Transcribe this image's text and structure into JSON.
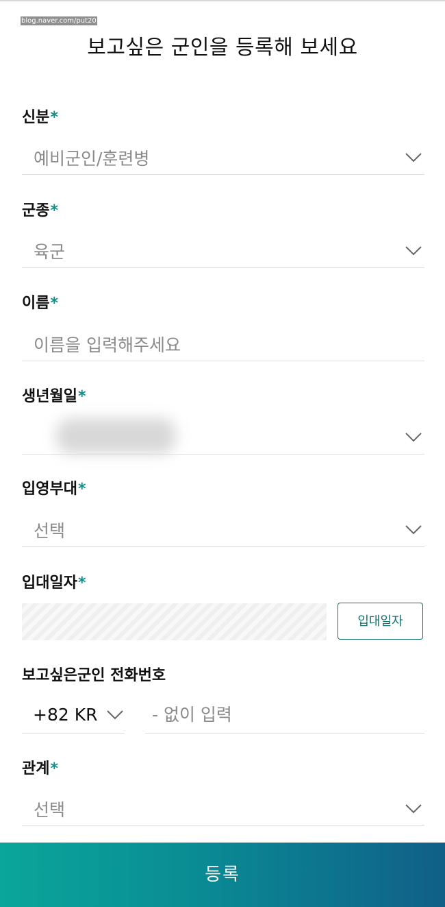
{
  "watermark": "blog.naver.com/put20",
  "page_title": "보고싶은 군인을 등록해 보세요",
  "required_mark": "*",
  "fields": {
    "status": {
      "label": "신분",
      "value": "예비군인/훈련병"
    },
    "branch": {
      "label": "군종",
      "value": "육군"
    },
    "name": {
      "label": "이름",
      "placeholder": "이름을 입력해주세요"
    },
    "birthdate": {
      "label": "생년월일",
      "value": ""
    },
    "unit": {
      "label": "입영부대",
      "value": "선택"
    },
    "enlist_date": {
      "label": "입대일자",
      "button_label": "입대일자"
    },
    "phone": {
      "label": "보고싶은군인 전화번호",
      "country_code": "+82 KR",
      "placeholder": "- 없이 입력"
    },
    "relation": {
      "label": "관계",
      "value": "선택"
    }
  },
  "submit_label": "등록",
  "icons": {
    "dropdown": "chevron-down-icon"
  },
  "colors": {
    "accent": "#0f8f86",
    "button_start": "#0aa69a",
    "button_end": "#105f88"
  }
}
